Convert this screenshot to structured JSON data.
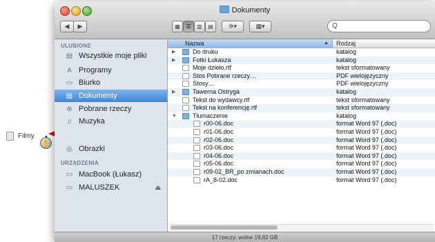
{
  "window": {
    "title": "Dokumenty"
  },
  "toolbar": {
    "back_icon": "◀",
    "forward_icon": "▶",
    "view_icons": [
      "icon-view-icon",
      "list-view-icon",
      "column-view-icon",
      "coverflow-view-icon"
    ],
    "action_label": "✲▾",
    "arrange_label": "▦▾",
    "search_glyph": "Q",
    "search_placeholder": ""
  },
  "sidebar": {
    "section_favorites": "ULUBIONE",
    "favorites": [
      {
        "label": "Wszystkie moje pliki",
        "icon": "all-files-icon",
        "glyph": "▤"
      },
      {
        "label": "Programy",
        "icon": "applications-icon",
        "glyph": "A"
      },
      {
        "label": "Biurko",
        "icon": "desktop-icon",
        "glyph": "▭"
      },
      {
        "label": "Dokumenty",
        "icon": "documents-icon",
        "glyph": "▤",
        "selected": true
      },
      {
        "label": "Pobrane rzeczy",
        "icon": "downloads-icon",
        "glyph": "⊕"
      },
      {
        "label": "Muzyka",
        "icon": "music-icon",
        "glyph": "♫"
      },
      {
        "label": "Obrazki",
        "icon": "pictures-icon",
        "glyph": "◎"
      }
    ],
    "section_devices": "URZĄDZENIA",
    "devices": [
      {
        "label": "MacBook (Łukasz)",
        "icon": "laptop-icon",
        "glyph": "▭"
      },
      {
        "label": "MALUSZEK",
        "icon": "drive-icon",
        "glyph": "▭",
        "eject": "⏏"
      }
    ]
  },
  "columns": {
    "name": "Nazwa",
    "kind": "Rodzaj",
    "sort_arrow": "▲"
  },
  "files": [
    {
      "name": "Do druku",
      "kind": "katalog",
      "type": "folder",
      "expand": "▶",
      "indent": 0
    },
    {
      "name": "Fotki Łukasza",
      "kind": "katalog",
      "type": "folder",
      "expand": "▶",
      "indent": 0
    },
    {
      "name": "Moje dzieło.rtf",
      "kind": "tekst sformatowany",
      "type": "doc",
      "expand": "",
      "indent": 0
    },
    {
      "name": "Stos Pobrane rzeczy…",
      "kind": "PDF wielojęzyczny",
      "type": "doc",
      "expand": "",
      "indent": 0
    },
    {
      "name": "Stosy…",
      "kind": "PDF wielojęzyczny",
      "type": "doc",
      "expand": "",
      "indent": 0
    },
    {
      "name": "Tawerna Ostryga",
      "kind": "katalog",
      "type": "folder",
      "expand": "▶",
      "indent": 0
    },
    {
      "name": "Tekst do wydawcy.rtf",
      "kind": "tekst sformatowany",
      "type": "doc",
      "expand": "",
      "indent": 0
    },
    {
      "name": "Tekst na konferencję.rtf",
      "kind": "tekst sformatowany",
      "type": "doc",
      "expand": "",
      "indent": 0
    },
    {
      "name": "Tłumaczenie",
      "kind": "katalog",
      "type": "folder",
      "expand": "▼",
      "indent": 0
    },
    {
      "name": "r00-06.doc",
      "kind": "format Word 97 (.doc)",
      "type": "doc",
      "expand": "",
      "indent": 1
    },
    {
      "name": "r01-06.doc",
      "kind": "format Word 97 (.doc)",
      "type": "doc",
      "expand": "",
      "indent": 1
    },
    {
      "name": "r02-06.doc",
      "kind": "format Word 97 (.doc)",
      "type": "doc",
      "expand": "",
      "indent": 1
    },
    {
      "name": "r03-06.doc",
      "kind": "format Word 97 (.doc)",
      "type": "doc",
      "expand": "",
      "indent": 1
    },
    {
      "name": "r04-06.doc",
      "kind": "format Word 97 (.doc)",
      "type": "doc",
      "expand": "",
      "indent": 1
    },
    {
      "name": "r05-06.doc",
      "kind": "format Word 97 (.doc)",
      "type": "doc",
      "expand": "",
      "indent": 1
    },
    {
      "name": "r09-02_BR_po zmianach.doc",
      "kind": "format Word 97 (.doc)",
      "type": "doc",
      "expand": "",
      "indent": 1
    },
    {
      "name": "rA_8-02.doc",
      "kind": "format Word 97 (.doc)",
      "type": "doc",
      "expand": "",
      "indent": 1
    }
  ],
  "status": "17 rzeczy; wolne 19,82 GB",
  "drag": {
    "label": "Filmy",
    "cursor": "▲",
    "badge": "✋"
  },
  "colors": {
    "selection": "#3f88d6",
    "sidebar": "#dde4ec",
    "arrow": "#d0111b"
  }
}
